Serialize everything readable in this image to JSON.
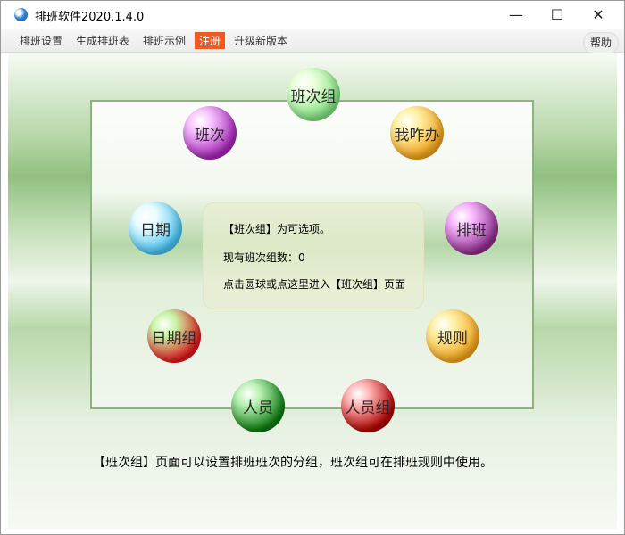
{
  "window": {
    "title": "排班软件2020.1.4.0"
  },
  "controls": {
    "minimize": "—",
    "maximize": "☐",
    "close": "✕"
  },
  "menu": {
    "items": [
      "排班设置",
      "生成排班表",
      "排班示例",
      "注册",
      "升级新版本"
    ],
    "active_index": 3,
    "help": "帮助"
  },
  "balls": [
    {
      "label": "班次组",
      "colors": [
        "#e8ffd8",
        "#7fe07f"
      ]
    },
    {
      "label": "班次",
      "colors": [
        "#f6c3ff",
        "#a624b8"
      ]
    },
    {
      "label": "我咋办",
      "colors": [
        "#fff2a6",
        "#f3a21a"
      ]
    },
    {
      "label": "日期",
      "colors": [
        "#e7fbff",
        "#45c2f2"
      ]
    },
    {
      "label": "排班",
      "colors": [
        "#f8b8ff",
        "#8e2c8d"
      ]
    },
    {
      "label": "日期组",
      "colors": [
        "#c7f5a6",
        "#e3161b"
      ]
    },
    {
      "label": "规则",
      "colors": [
        "#fff0a5",
        "#f2a317"
      ]
    },
    {
      "label": "人员",
      "colors": [
        "#b8f1b2",
        "#0c7c0f"
      ]
    },
    {
      "label": "人员组",
      "colors": [
        "#ffb3b3",
        "#b20000"
      ]
    }
  ],
  "info": {
    "line1": "【班次组】为可选项。",
    "line2": "现有班次组数：0",
    "line3": "点击圆球或点这里进入【班次组】页面"
  },
  "footer": "【班次组】页面可以设置排班班次的分组，班次组可在排班规则中使用。"
}
